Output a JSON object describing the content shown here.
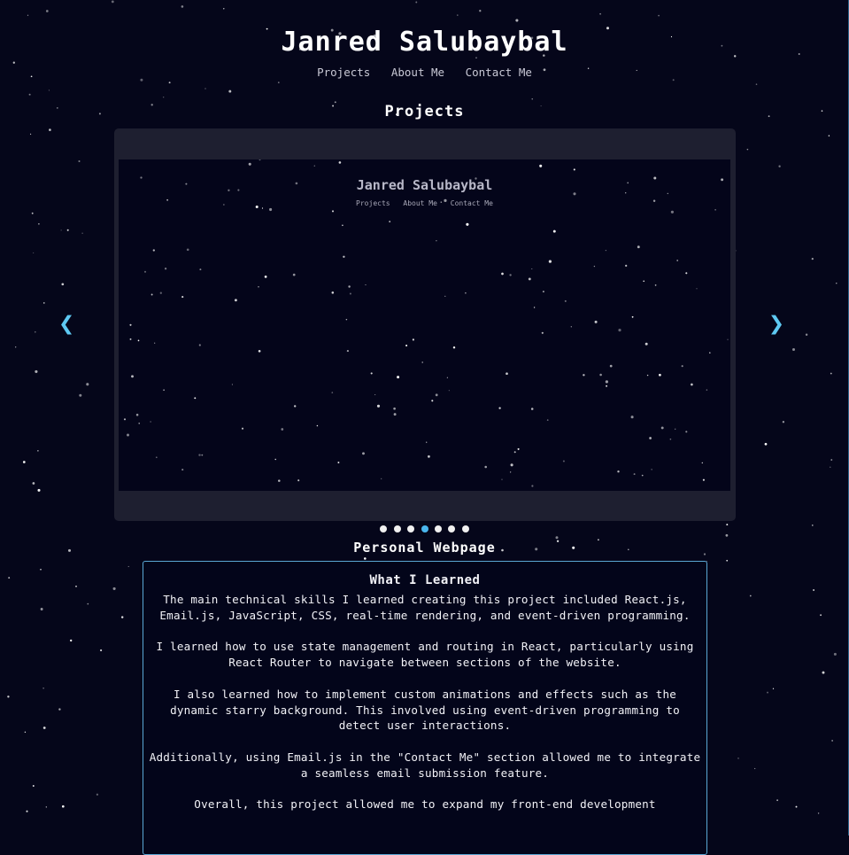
{
  "header": {
    "title": "Janred Salubaybal",
    "nav": [
      "Projects",
      "About Me",
      "Contact Me"
    ]
  },
  "projects": {
    "heading": "Projects",
    "preview": {
      "title": "Janred Salubaybal",
      "nav": [
        "Projects",
        "About Me",
        "Contact Me"
      ]
    },
    "prev_icon": "chevron-left",
    "next_icon": "chevron-right",
    "dot_count": 7,
    "active_index": 3,
    "current_project": "Personal Webpage"
  },
  "learned": {
    "heading": "What I Learned",
    "paragraphs": [
      "The main technical skills I learned creating this project included React.js, Email.js, JavaScript, CSS, real-time rendering, and event-driven programming.",
      "I learned how to use state management and routing in React, particularly using React Router to navigate between sections of the website.",
      "I also learned how to implement custom animations and effects such as the dynamic starry background. This involved using event-driven programming to detect user interactions.",
      "Additionally, using Email.js in the \"Contact Me\" section allowed me to integrate a seamless email submission feature.",
      "Overall, this project allowed me to expand my front-end development"
    ]
  },
  "colors": {
    "background": "#05061a",
    "accent": "#4ab6ee",
    "frame": "#1e1f30",
    "card_border": "#5aa7d4"
  }
}
